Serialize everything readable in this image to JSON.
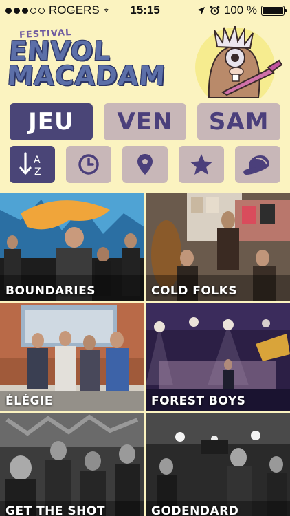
{
  "status_bar": {
    "carrier": "ROGERS",
    "time": "15:15",
    "battery": "100 %"
  },
  "header": {
    "logo_small": "FESTIVAL",
    "logo_line1": "ENVOL",
    "logo_line2": "MACADAM"
  },
  "day_tabs": [
    {
      "label": "JEU",
      "active": true
    },
    {
      "label": "VEN",
      "active": false
    },
    {
      "label": "SAM",
      "active": false
    }
  ],
  "filters": [
    {
      "icon": "sort-az-icon",
      "active": true
    },
    {
      "icon": "clock-icon",
      "active": false
    },
    {
      "icon": "location-pin-icon",
      "active": false
    },
    {
      "icon": "star-icon",
      "active": false
    },
    {
      "icon": "cap-icon",
      "active": false
    }
  ],
  "bands": [
    {
      "name": "BOUNDARIES"
    },
    {
      "name": "COLD FOLKS"
    },
    {
      "name": "ÉLÉGIE"
    },
    {
      "name": "FOREST BOYS"
    },
    {
      "name": "GET THE SHOT"
    },
    {
      "name": "GODENDARD"
    }
  ],
  "colors": {
    "background": "#fbf3c0",
    "active_tab": "#4a4577",
    "inactive_tab": "#c8b7b8",
    "inactive_text": "#4b3f7b"
  }
}
